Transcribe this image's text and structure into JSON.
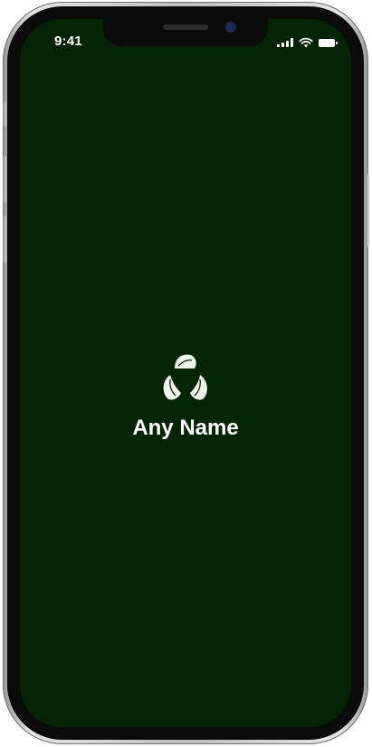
{
  "status_bar": {
    "time": "9:41",
    "icons": [
      "cellular-signal-icon",
      "wifi-icon",
      "battery-icon"
    ]
  },
  "splash": {
    "logo_icon": "recycle-leaves-icon",
    "app_name": "Any Name"
  },
  "colors": {
    "screen_background": "#052404",
    "text": "#ffffff",
    "logo": "#eef5ea"
  }
}
